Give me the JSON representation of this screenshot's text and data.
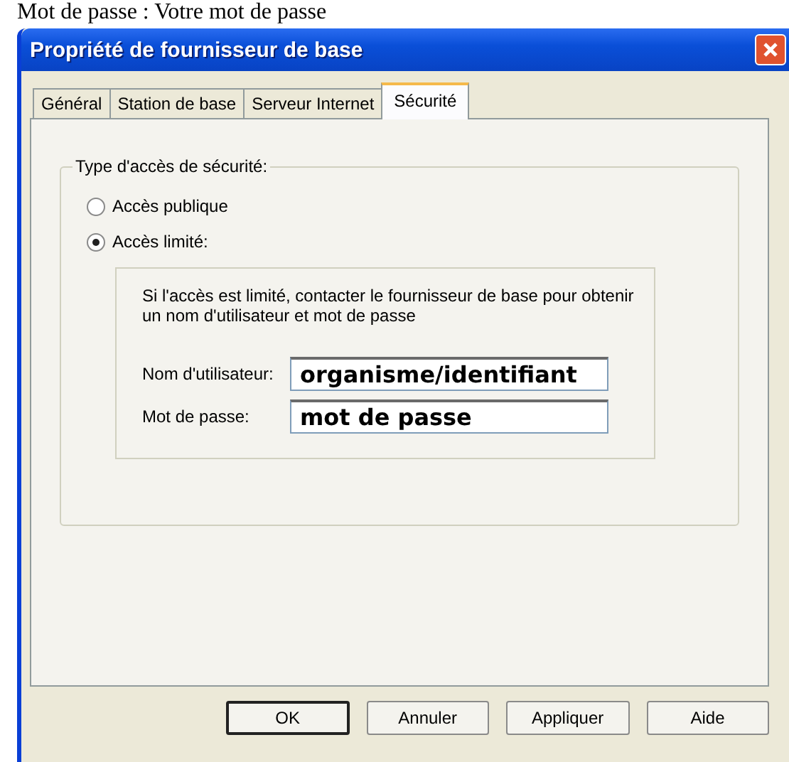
{
  "caption": "Mot de passe : Votre mot de passe",
  "window": {
    "title": "Propriété de fournisseur de base"
  },
  "tabs": [
    {
      "label": "Général",
      "selected": false
    },
    {
      "label": "Station de base",
      "selected": false
    },
    {
      "label": "Serveur Internet",
      "selected": false
    },
    {
      "label": "Sécurité",
      "selected": true
    }
  ],
  "group": {
    "title": "Type d'accès de sécurité:",
    "options": [
      {
        "label": "Accès publique",
        "selected": false
      },
      {
        "label": "Accès limité:",
        "selected": true
      }
    ],
    "note": "Si l'accès est limité, contacter le fournisseur de base pour obtenir un nom d'utilisateur et mot de passe",
    "fields": [
      {
        "label": "Nom d'utilisateur:",
        "value": "organisme/identifiant"
      },
      {
        "label": "Mot de passe:",
        "value": "mot de passe"
      }
    ]
  },
  "buttons": [
    {
      "label": "OK",
      "default": true
    },
    {
      "label": "Annuler",
      "default": false
    },
    {
      "label": "Appliquer",
      "default": false
    },
    {
      "label": "Aide",
      "default": false
    }
  ]
}
